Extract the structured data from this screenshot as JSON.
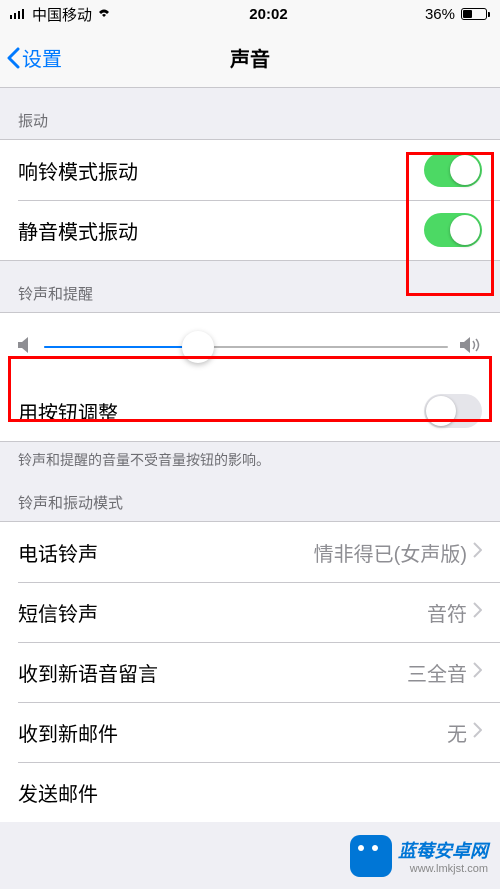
{
  "status": {
    "carrier": "中国移动",
    "time": "20:02",
    "battery": "36%"
  },
  "nav": {
    "back": "设置",
    "title": "声音"
  },
  "sections": {
    "vibrate": {
      "header": "振动",
      "ring": "响铃模式振动",
      "silent": "静音模式振动"
    },
    "ringer": {
      "header": "铃声和提醒",
      "button_label": "用按钮调整",
      "footer": "铃声和提醒的音量不受音量按钮的影响。",
      "slider_value": 38
    },
    "patterns": {
      "header": "铃声和振动模式",
      "ringtone": {
        "label": "电话铃声",
        "value": "情非得已(女声版)"
      },
      "texttone": {
        "label": "短信铃声",
        "value": "音符"
      },
      "voicemail": {
        "label": "收到新语音留言",
        "value": "三全音"
      },
      "mail": {
        "label": "收到新邮件",
        "value": "无"
      },
      "sentmail": {
        "label": "发送邮件",
        "value": ""
      }
    }
  },
  "watermark": {
    "name": "蓝莓安卓网",
    "url": "www.lmkjst.com"
  }
}
